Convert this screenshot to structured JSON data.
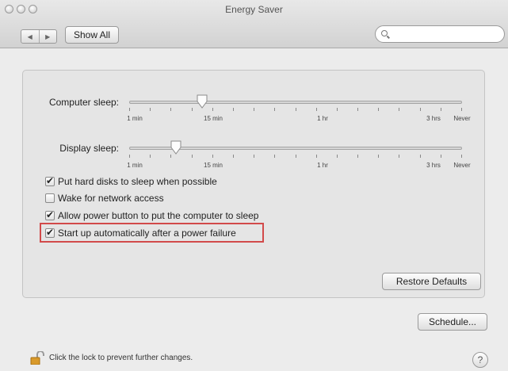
{
  "window": {
    "title": "Energy Saver"
  },
  "toolbar": {
    "back_label": "◀",
    "forward_label": "▶",
    "show_all_label": "Show All",
    "search_placeholder": "",
    "search_value": ""
  },
  "computer_sleep": {
    "label": "Computer sleep:",
    "value_fraction": 0.22
  },
  "display_sleep": {
    "label": "Display sleep:",
    "value_fraction": 0.14
  },
  "scale_labels": [
    "1 min",
    "15 min",
    "1 hr",
    "3 hrs",
    "Never"
  ],
  "options": [
    {
      "label": "Put hard disks to sleep when possible",
      "checked": true
    },
    {
      "label": "Wake for network access",
      "checked": false
    },
    {
      "label": "Allow power button to put the computer to sleep",
      "checked": true
    },
    {
      "label": "Start up automatically after a power failure",
      "checked": true
    }
  ],
  "buttons": {
    "restore_defaults": "Restore Defaults",
    "schedule": "Schedule..."
  },
  "footer": {
    "lock_text": "Click the lock to prevent further changes.",
    "help_label": "?"
  },
  "colors": {
    "highlight": "#d24a4a"
  }
}
